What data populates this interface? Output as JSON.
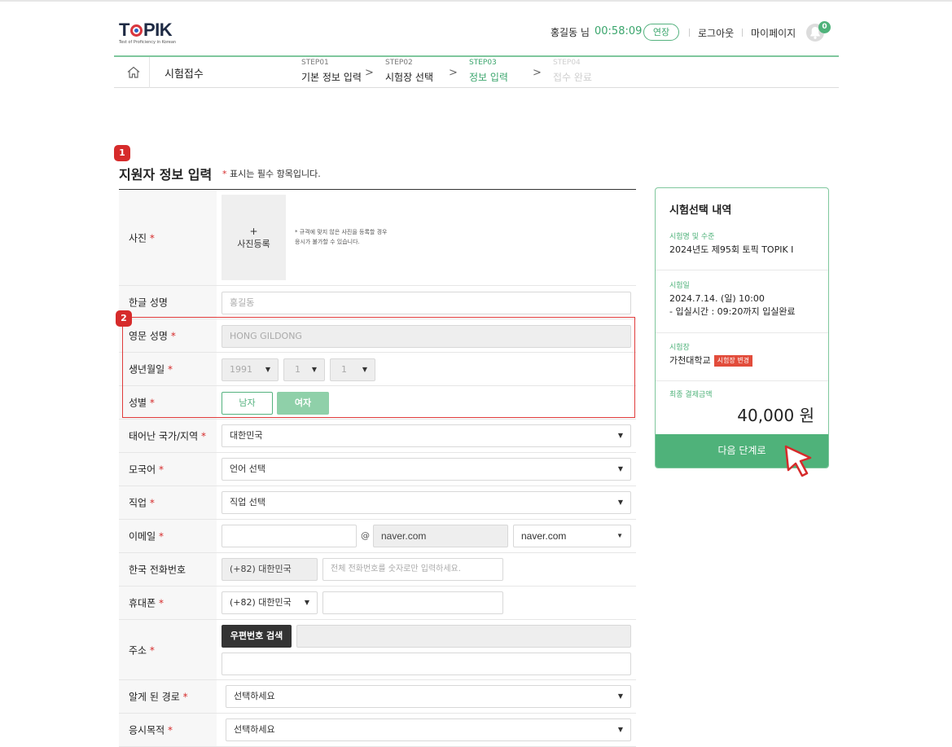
{
  "header": {
    "logo": "TOPIK",
    "logo_sub": "Test of Proficiency in Korean",
    "user": "홍길동 님",
    "timer": "00:58:09",
    "extend": "연장",
    "logout": "로그아웃",
    "mypage": "마이페이지",
    "notification_count": "0",
    "icons": {
      "bell": "bell-icon",
      "home": "home-icon"
    }
  },
  "nav": {
    "title": "시험접수",
    "steps": [
      {
        "num": "STEP01",
        "label": "기본 정보 입력",
        "state": "done"
      },
      {
        "num": "STEP02",
        "label": "시험장 선택",
        "state": "done"
      },
      {
        "num": "STEP03",
        "label": "정보 입력",
        "state": "active"
      },
      {
        "num": "STEP04",
        "label": "접수 완료",
        "state": "pending"
      }
    ]
  },
  "markers": {
    "m1": "1",
    "m2": "2"
  },
  "section": {
    "title": "지원자 정보 입력",
    "note_star": "*",
    "note": " 표시는 필수 항목입니다."
  },
  "form": {
    "req": "*",
    "photo": {
      "label": "사진",
      "plus": "+",
      "button": "사진등록",
      "note1": "* 규격에 맞지 않은 사진을 등록할 경우",
      "note2": "응시가 불가할 수 있습니다."
    },
    "korean_name": {
      "label": "한글 성명",
      "placeholder": "홍길동"
    },
    "english_name": {
      "label": "영문 성명",
      "value": "HONG GILDONG"
    },
    "birth": {
      "label": "생년월일",
      "year": "1991",
      "month": "1",
      "day": "1"
    },
    "gender": {
      "label": "성별",
      "male": "남자",
      "female": "여자"
    },
    "country": {
      "label": "태어난 국가/지역",
      "value": "대한민국"
    },
    "language": {
      "label": "모국어",
      "value": "언어 선택"
    },
    "job": {
      "label": "직업",
      "value": "직업 선택"
    },
    "email": {
      "label": "이메일",
      "at": "@",
      "domain": "naver.com",
      "domain_select": "naver.com"
    },
    "korea_phone": {
      "label": "한국 전화번호",
      "country": "(+82) 대한민국",
      "placeholder": "전체 전화번호를 숫자로만 입력하세요."
    },
    "mobile": {
      "label": "휴대폰",
      "country": "(+82) 대한민국"
    },
    "address": {
      "label": "주소",
      "zip_button": "우편번호 검색"
    },
    "source": {
      "label": "알게 된 경로",
      "value": "선택하세요"
    },
    "purpose": {
      "label": "응시목적",
      "value": "선택하세요"
    },
    "arrow": "▼"
  },
  "summary": {
    "title": "시험선택 내역",
    "exam_key": "시험명 및 수준",
    "exam_val": "2024년도 제95회 토픽 TOPIK I",
    "date_key": "시험일",
    "date_val": "2024.7.14. (일) 10:00",
    "date_sub": "- 입실시간 : 09:20까지 입실완료",
    "venue_key": "시험장",
    "venue_val": "가천대학교",
    "venue_change": "시험장 변경",
    "pay_key": "최종 결제금액",
    "amount": "40,000 원",
    "next": "다음 단계로"
  },
  "colors": {
    "accent": "#4fb27a",
    "required": "#d62b2b",
    "marker": "#d62b2b"
  }
}
